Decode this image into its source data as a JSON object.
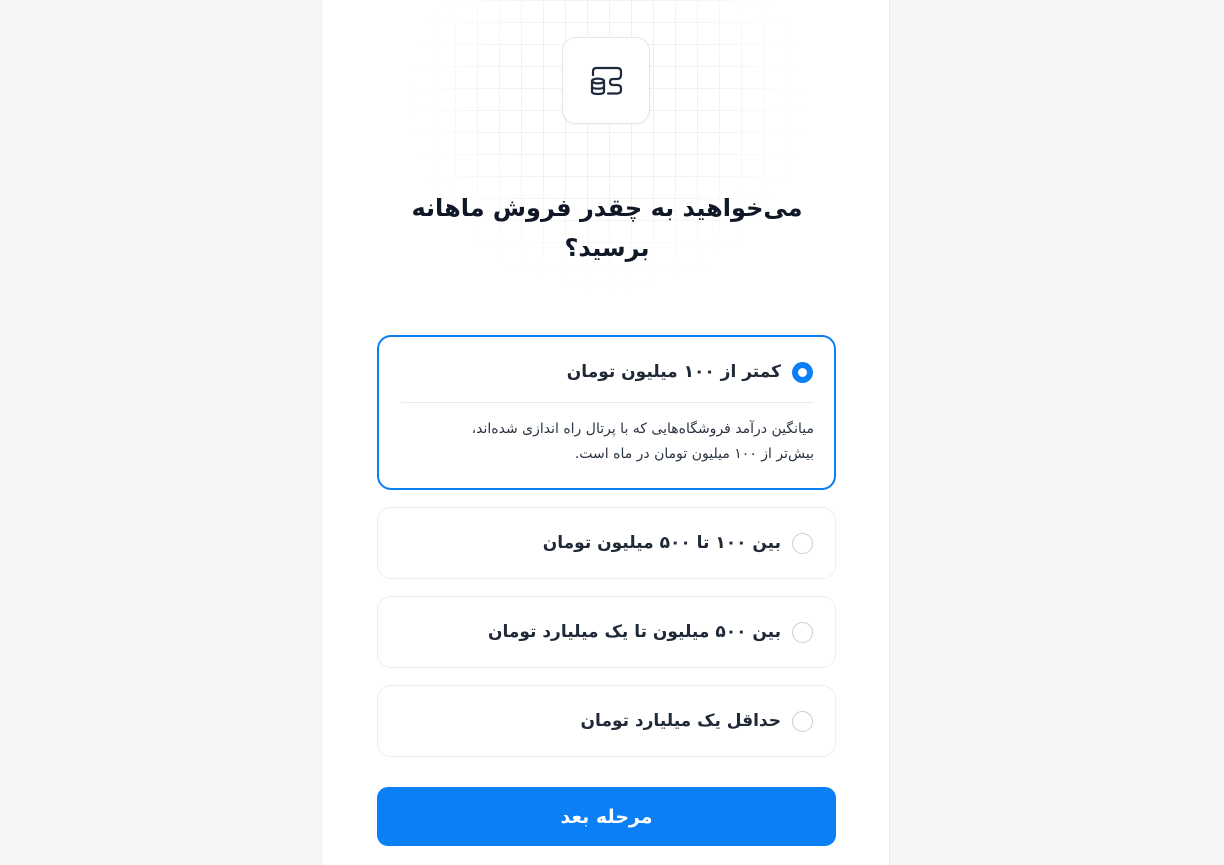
{
  "header": {
    "icon": "wallet-coins-icon",
    "title": "می‌خواهید به چقدر فروش ماهانه برسید؟"
  },
  "options": [
    {
      "label": "کمتر از ۱۰۰ میلیون تومان",
      "selected": true,
      "description_line1": "میانگین درآمد فروشگاه‌هایی که با پرتال راه اندازی شده‌اند،",
      "description_line2": "بیش‌تر از ۱۰۰ میلیون تومان در ماه است."
    },
    {
      "label": "بین ۱۰۰ تا ۵۰۰ میلیون تومان",
      "selected": false
    },
    {
      "label": "بین ۵۰۰ میلیون تا یک میلیارد تومان",
      "selected": false
    },
    {
      "label": "حداقل یک میلیارد تومان",
      "selected": false
    }
  ],
  "next_button": {
    "label": "مرحله بعد"
  },
  "colors": {
    "accent": "#0b7ff5",
    "background": "#f4f5f7",
    "panel": "#ffffff"
  }
}
